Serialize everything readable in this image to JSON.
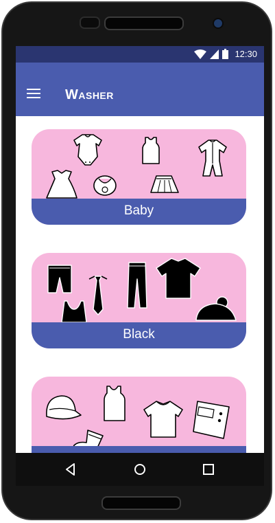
{
  "status_bar": {
    "time": "12:30",
    "icons": [
      "wifi-icon",
      "signal-icon",
      "battery-icon"
    ]
  },
  "app_bar": {
    "title": "Washer",
    "menu_icon": "hamburger-menu-icon"
  },
  "categories": [
    {
      "label": "Baby",
      "icons": [
        "bodysuit-icon",
        "tank-top-icon",
        "sleeper-icon",
        "baby-dress-icon",
        "bib-icon",
        "skirt-icon"
      ]
    },
    {
      "label": "Black",
      "icons": [
        "shorts-icon",
        "tie-icon",
        "trousers-icon",
        "tshirt-icon",
        "bra-top-icon",
        "beanie-icon"
      ]
    },
    {
      "label": "",
      "icons": [
        "cap-icon",
        "tank-top-icon",
        "tshirt-icon",
        "pocket-shorts-icon",
        "sock-icon"
      ]
    }
  ],
  "colors": {
    "status_bar": "#2a3570",
    "app_bar": "#4a5cae",
    "card_background": "#f7b7dd",
    "card_label": "#4a5cae"
  },
  "nav_bar": {
    "icons": [
      "back-icon",
      "home-icon",
      "recents-icon"
    ]
  }
}
